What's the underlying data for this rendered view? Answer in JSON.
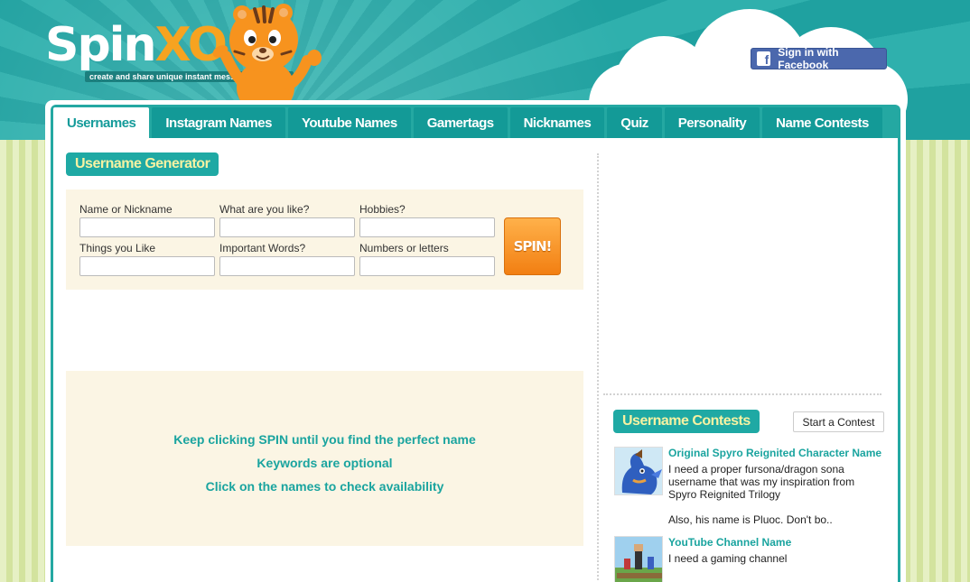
{
  "header": {
    "logo_spin": "Spin",
    "logo_xo": "XO",
    "tagline": "create and share unique instant messenger content",
    "facebook_button": "Sign in with Facebook"
  },
  "tabs": [
    {
      "label": "Usernames",
      "active": true
    },
    {
      "label": "Instagram Names",
      "active": false
    },
    {
      "label": "Youtube Names",
      "active": false
    },
    {
      "label": "Gamertags",
      "active": false
    },
    {
      "label": "Nicknames",
      "active": false
    },
    {
      "label": "Quiz",
      "active": false
    },
    {
      "label": "Personality",
      "active": false
    },
    {
      "label": "Name Contests",
      "active": false
    }
  ],
  "generator": {
    "title": "Username Generator",
    "fields": [
      {
        "label": "Name or Nickname",
        "value": ""
      },
      {
        "label": "What are you like?",
        "value": ""
      },
      {
        "label": "Hobbies?",
        "value": ""
      },
      {
        "label": "Things you Like",
        "value": ""
      },
      {
        "label": "Important Words?",
        "value": ""
      },
      {
        "label": "Numbers or letters",
        "value": ""
      }
    ],
    "spin_button": "SPIN!"
  },
  "tips": [
    "Keep clicking SPIN until you find the perfect name",
    "Keywords are optional",
    "Click on the names to check availability"
  ],
  "contests": {
    "title": "Username Contests",
    "start_button": "Start a Contest",
    "items": [
      {
        "title": "Original Spyro Reignited Character Name",
        "desc": "I need a proper fursona/dragon sona username that was my inspiration from Spyro Reignited Trilogy",
        "extra": "Also, his name is Pluoc. Don't bo.."
      },
      {
        "title": "YouTube Channel Name",
        "desc": "I need a gaming channel"
      }
    ]
  },
  "colors": {
    "teal": "#1fa9a4",
    "tab": "#139a97",
    "orange": "#f7a320",
    "facebook": "#4b68ad"
  }
}
